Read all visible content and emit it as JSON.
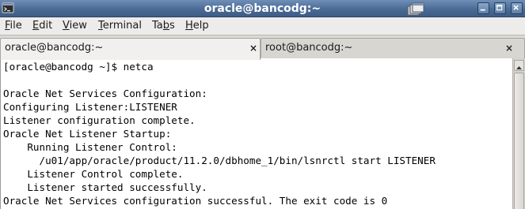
{
  "window": {
    "title": "oracle@bancodg:~"
  },
  "menubar": {
    "items": [
      {
        "accel": "F",
        "rest": "ile"
      },
      {
        "accel": "E",
        "rest": "dit"
      },
      {
        "accel": "V",
        "rest": "iew"
      },
      {
        "accel": "T",
        "rest": "erminal"
      },
      {
        "pre": "Ta",
        "accel": "b",
        "rest": "s"
      },
      {
        "accel": "H",
        "rest": "elp"
      }
    ]
  },
  "tabs": [
    {
      "label": "oracle@bancodg:~",
      "close": "×",
      "active": true
    },
    {
      "label": "root@bancodg:~",
      "close": "×",
      "active": false
    }
  ],
  "terminal": {
    "lines": [
      "[oracle@bancodg ~]$ netca",
      "",
      "Oracle Net Services Configuration:",
      "Configuring Listener:LISTENER",
      "Listener configuration complete.",
      "Oracle Net Listener Startup:",
      "    Running Listener Control:",
      "      /u01/app/oracle/product/11.2.0/dbhome_1/bin/lsnrctl start LISTENER",
      "    Listener Control complete.",
      "    Listener started successfully.",
      "Oracle Net Services configuration successful. The exit code is 0"
    ]
  },
  "icons": {
    "app": "terminal-icon",
    "workspace": "window-stack-icon",
    "minimize": "minimize-icon",
    "maximize": "maximize-icon",
    "close": "close-icon",
    "scroll_up": "arrow-up-icon"
  },
  "colors": {
    "titlebar": "#4a6b95",
    "menubar": "#edecea",
    "tab_active": "#f1f0ee",
    "terminal_bg": "#ffffff",
    "terminal_fg": "#000000"
  }
}
